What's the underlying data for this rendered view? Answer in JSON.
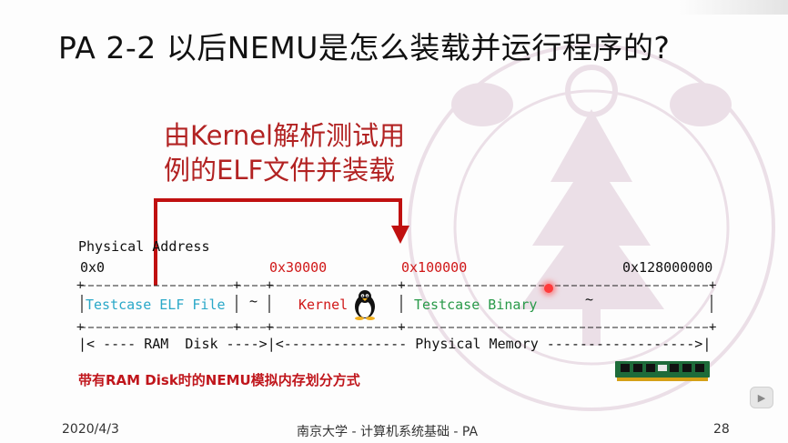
{
  "slide": {
    "title": "PA 2-2 以后NEMU是怎么装载并运行程序的?",
    "note_line1": "由Kernel解析测试用",
    "note_line2": "例的ELF文件并装载",
    "label_physical_address": "Physical Address",
    "addr_0": "0x0",
    "addr_30000": "0x30000",
    "addr_100000": "0x100000",
    "addr_128000000": "0x128000000",
    "row_top_border": "+------------------+--------+------------+--------+--------------------+-------------------------------+",
    "seg_testcase_elf": "Testcase ELF File",
    "seg_kernel": "Kernel",
    "seg_testcase_binary": "Testcase Binary",
    "tilde": "~",
    "row_bottom_border": "+------------------+--------+------------+--------+--------------------+-------------------------------+",
    "ram_disk_label": "|< ---- RAM  Disk ---->|<--------------- Physical Memory ------------------>|",
    "caption": "带有RAM Disk时的NEMU模拟内存划分方式",
    "footer_date": "2020/4/3",
    "footer_center": "南京大学 - 计算机系统基础 - PA",
    "footer_page": "28"
  },
  "icons": {
    "tux": "tux-penguin-icon",
    "ram": "ram-stick-icon",
    "watermark": "university-seal-watermark",
    "laser": "laser-pointer-icon",
    "play": "play-control-icon"
  },
  "colors": {
    "note_red": "#b22222",
    "address_red": "#d01818",
    "elf_cyan": "#2aa8c8",
    "binary_green": "#2a9a4a",
    "watermark": "#7a1f5c"
  }
}
